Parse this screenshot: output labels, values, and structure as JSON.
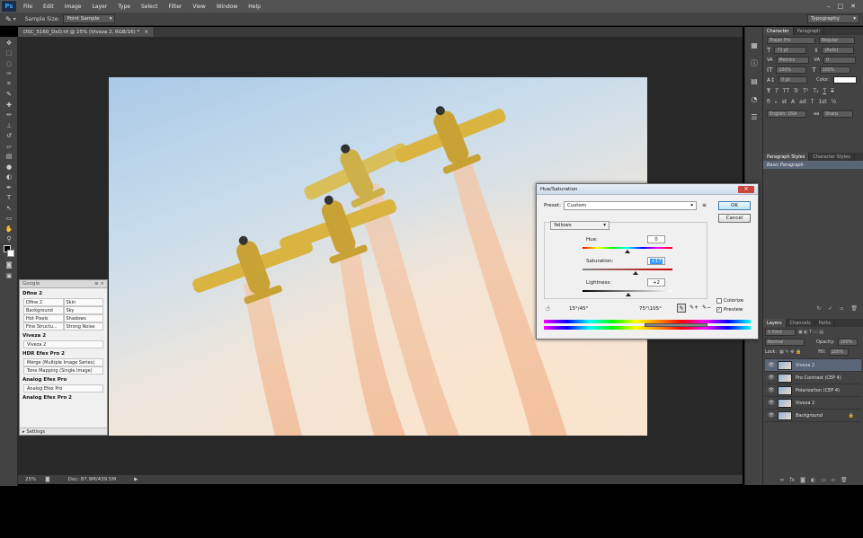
{
  "app": {
    "logo": "Ps",
    "menu": [
      "File",
      "Edit",
      "Image",
      "Layer",
      "Type",
      "Select",
      "Filter",
      "View",
      "Window",
      "Help"
    ],
    "window_controls": [
      "–",
      "□",
      "✕"
    ]
  },
  "options_bar": {
    "sample_size_label": "Sample Size:",
    "sample_size_value": "Point Sample",
    "workspace": "Typography"
  },
  "document": {
    "tab_title": "DSC_5160_DxO.tif @ 25% (Viveza 2, RGB/16) *",
    "tab_close": "×"
  },
  "status_bar": {
    "zoom": "25%",
    "doc_size": "Doc: 87.9M/439.5M",
    "arrow": "▶"
  },
  "google_panel": {
    "title": "Google",
    "sections": [
      {
        "name": "Dfine 2",
        "grid": [
          "Dfine 2",
          "Skin",
          "Background",
          "Sky",
          "Hot Pixels",
          "Shadows",
          "Fine Structu...",
          "Strong Noise"
        ]
      },
      {
        "name": "Viveza 2",
        "buttons": [
          "Viveza 2"
        ]
      },
      {
        "name": "HDR Efex Pro 2",
        "buttons": [
          "Merge (Multiple Image Series)",
          "Tone Mapping (Single Image)"
        ]
      },
      {
        "name": "Analog Efex Pro",
        "buttons": [
          "Analog Efex Pro"
        ]
      },
      {
        "name": "Analog Efex Pro 2",
        "buttons": []
      }
    ],
    "footer": "Settings"
  },
  "character_panel": {
    "tabs": [
      "Character",
      "Paragraph"
    ],
    "font_family": "Trajan Pro",
    "font_style": "Regular",
    "size": "72 pt",
    "leading": "(Auto)",
    "kerning": "Metrics",
    "tracking": "0",
    "vscale": "100%",
    "hscale": "100%",
    "baseline": "0 pt",
    "color_label": "Color:",
    "style_buttons": [
      "T",
      "T",
      "TT",
      "Tr",
      "T¹",
      "T₁",
      "T",
      "T"
    ],
    "extra_buttons": [
      "fi",
      "ℴ",
      "st",
      "A",
      "ad",
      "T",
      "1st",
      "½"
    ],
    "language": "English: USA",
    "aa_label": "aa",
    "antialias": "Sharp"
  },
  "paragraph_styles": {
    "tabs": [
      "Paragraph Styles",
      "Character Styles"
    ],
    "items": [
      "Basic Paragraph"
    ]
  },
  "layers_panel": {
    "tabs": [
      "Layers",
      "Channels",
      "Paths"
    ],
    "kind_label": "Kind",
    "blend_mode": "Normal",
    "opacity_label": "Opacity:",
    "opacity": "100%",
    "lock_label": "Lock:",
    "fill_label": "Fill:",
    "fill": "100%",
    "layers": [
      {
        "name": "Viveza 2",
        "selected": true,
        "locked": false
      },
      {
        "name": "Pro Contrast (CEP 4)",
        "selected": false,
        "locked": false
      },
      {
        "name": "Polarization (CEP 4)",
        "selected": false,
        "locked": false
      },
      {
        "name": "Viveza 2",
        "selected": false,
        "locked": false
      },
      {
        "name": "Background",
        "selected": false,
        "locked": true
      }
    ],
    "footer_icons": [
      "link-icon",
      "fx-icon",
      "mask-icon",
      "adjustment-icon",
      "folder-icon",
      "new-layer-icon",
      "trash-icon"
    ]
  },
  "dialog": {
    "title": "Hue/Saturation",
    "preset_label": "Preset:",
    "preset_value": "Custom",
    "channel": "Yellows",
    "hue_label": "Hue:",
    "hue_value": "0",
    "saturation_label": "Saturation:",
    "saturation_value": "+17",
    "lightness_label": "Lightness:",
    "lightness_value": "+2",
    "range_left": "15°/45°",
    "range_right": "75°\\105°",
    "ok": "OK",
    "cancel": "Cancel",
    "colorize_label": "Colorize",
    "colorize": false,
    "preview_label": "Preview",
    "preview": true
  },
  "colors": {
    "ps_blue": "#31a8ff",
    "selected_layer": "#5a6578",
    "selection_highlight": "#3399ff"
  }
}
